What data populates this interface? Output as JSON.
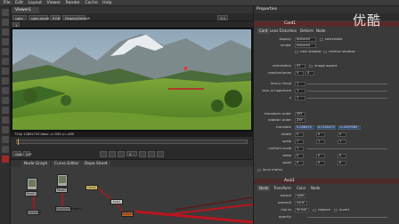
{
  "menu": [
    "File",
    "Edit",
    "Layout",
    "Viewer",
    "Render",
    "Cache",
    "Help"
  ],
  "viewer": {
    "tab_label": "Viewer1",
    "channel": "rgba",
    "layer": "rgba.alpha",
    "display": "RGB",
    "input": "DisplayDefault",
    "zoom": "1:1",
    "gain": "1",
    "info": "720p 1280x720 bbox: x=540 y=-480",
    "frame": "1",
    "end_frame": "100"
  },
  "playback": {
    "fps": "24*",
    "frame_field": "1",
    "range": "Global"
  },
  "node_graph": {
    "tabs": [
      "Node Graph",
      "Curve Editor",
      "Dope Sheet"
    ],
    "nodes": [
      {
        "label": "Read1",
        "kind": "read"
      },
      {
        "label": "Read2",
        "kind": "read"
      },
      {
        "label": "Card1",
        "kind": "card"
      },
      {
        "label": "Axis1",
        "kind": "axis"
      },
      {
        "label": "Scene1",
        "kind": "scene"
      },
      {
        "label": "Camera1",
        "kind": "camera"
      },
      {
        "label": "ScanlineRender1",
        "kind": "render"
      }
    ]
  },
  "properties": {
    "title": "Properties",
    "node_name": "Card1",
    "tabs": [
      "Card",
      "Lens Distortion",
      "Deform",
      "Node"
    ],
    "display": "textured",
    "selectable": "selectable",
    "render": "textured",
    "cast_shadow": "cast shadow",
    "receive_shadow": "receive shadow",
    "orientation_label": "orientation",
    "orientation": "XY",
    "image_aspect": "image aspect",
    "rows_label": "rows/columns",
    "rows": "4",
    "columns": "4",
    "lens_label": "lens-in focal",
    "lens_focal": "1",
    "lens_aperture_label": "lens-in haperture",
    "lens_aperture": "1",
    "z_label": "z",
    "z": "1",
    "transform_order_label": "transform order",
    "transform_order": "SRT",
    "rotation_order_label": "rotation order",
    "rotation_order": "ZXY",
    "translate_label": "translate",
    "translate": [
      "0.008474",
      "0.0100472",
      "-0.0229583"
    ],
    "rotate_label": "rotate",
    "rotate": [
      "0",
      "0",
      "0"
    ],
    "scale_label": "scale",
    "scale": [
      "1",
      "1",
      "1"
    ],
    "uniform_scale_label": "uniform scale",
    "uniform_scale": "1",
    "skew_label": "skew",
    "skew": [
      "0",
      "0",
      "0"
    ],
    "pivot_label": "pivot",
    "pivot": [
      "0",
      "0",
      "0"
    ],
    "local_matrix_label": "local matrix",
    "node2_name": "Axis1",
    "node2_tabs": [
      "Node",
      "Transform",
      "Color",
      "Node"
    ],
    "output_label": "output",
    "output": "rgba",
    "premult_label": "premult",
    "premult": "none",
    "clip_to_label": "clip to",
    "clip_to": "format",
    "replace": "replace",
    "invert": "invert",
    "opacity_label": "opacity"
  },
  "watermark": "优酷",
  "colors": {
    "accent": "#8a2a2a",
    "panel": "#3a3a3a",
    "node_card": "#d9c36a",
    "node_read": "#aaaaaa",
    "pipe": "#b8151d"
  }
}
